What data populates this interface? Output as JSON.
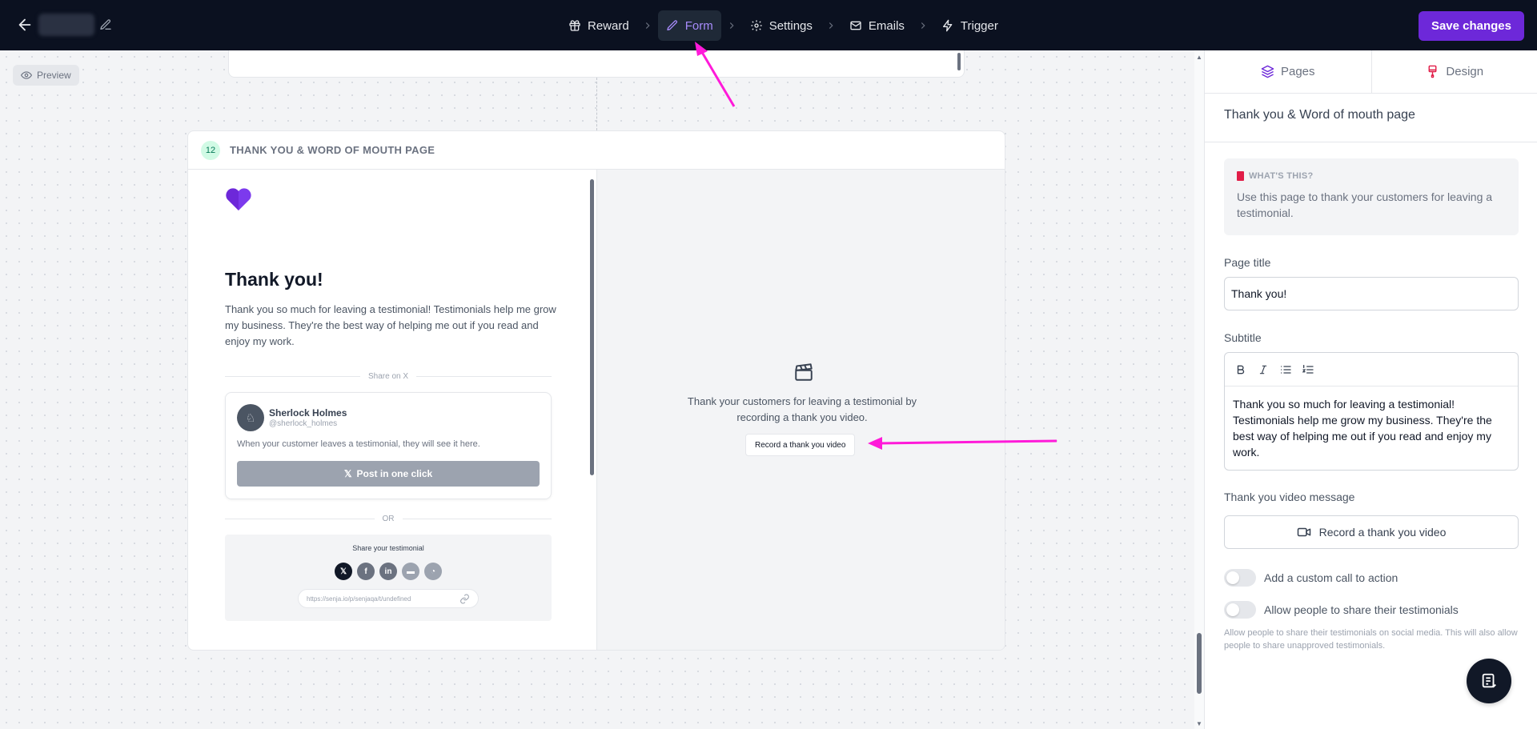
{
  "topbar": {
    "steps": [
      {
        "label": "Reward",
        "icon": "gift-icon"
      },
      {
        "label": "Form",
        "icon": "pencil-icon",
        "active": true
      },
      {
        "label": "Settings",
        "icon": "gear-icon"
      },
      {
        "label": "Emails",
        "icon": "mail-icon"
      },
      {
        "label": "Trigger",
        "icon": "lightning-icon"
      }
    ],
    "save_label": "Save changes"
  },
  "canvas": {
    "preview_label": "Preview",
    "page": {
      "number": "12",
      "label": "THANK YOU & WORD OF MOUTH PAGE",
      "title": "Thank you!",
      "body": "Thank you so much for leaving a testimonial! Testimonials help me grow my business. They're the best way of helping me out if you read and enjoy my work.",
      "share_on_x": "Share on X",
      "tweet": {
        "name": "Sherlock Holmes",
        "handle": "@sherlock_holmes",
        "text": "When your customer leaves a testimonial, they will see it here.",
        "button": "Post in one click"
      },
      "or_label": "OR",
      "share": {
        "title": "Share your testimonial",
        "icons": [
          "x-icon",
          "facebook-icon",
          "linkedin-icon",
          "chat-icon",
          "whatsapp-icon"
        ],
        "link": "https://senja.io/p/senjaqa/t/undefined"
      },
      "video": {
        "description": "Thank your customers for leaving a testimonial by recording a thank you video.",
        "button": "Record a thank you video"
      }
    }
  },
  "panel": {
    "tabs": [
      {
        "label": "Pages",
        "icon": "layers-icon"
      },
      {
        "label": "Design",
        "icon": "brush-icon"
      }
    ],
    "title": "Thank you & Word of mouth page",
    "info": {
      "heading": "WHAT'S THIS?",
      "text": "Use this page to thank your customers for leaving a testimonial."
    },
    "page_title_label": "Page title",
    "page_title_value": "Thank you!",
    "subtitle_label": "Subtitle",
    "subtitle_value": "Thank you so much for leaving a testimonial! Testimonials help me grow my business. They're the best way of helping me out if you read and enjoy my work.",
    "video_label": "Thank you video message",
    "record_button": "Record a thank you video",
    "toggles": [
      {
        "label": "Add a custom call to action",
        "on": false
      },
      {
        "label": "Allow people to share their testimonials",
        "on": false
      }
    ],
    "toggle_help": "Allow people to share their testimonials on social media. This will also allow people to share unapproved testimonials."
  },
  "colors": {
    "topbar_bg": "#0b1120",
    "accent": "#6d28d9",
    "annotation_arrow": "#ff1ad9"
  }
}
